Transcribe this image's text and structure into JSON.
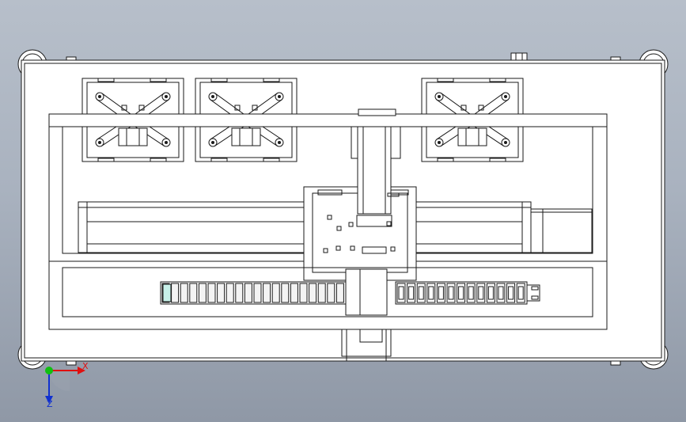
{
  "triad": {
    "x_label": "X",
    "z_label": "Z",
    "x_color": "#e01010",
    "z_color": "#1030d0",
    "origin_color": "#10c010"
  },
  "colors": {
    "background_top": "#b7bfca",
    "background_bottom": "#8f98a6",
    "part_fill": "#ffffff",
    "edge_line": "#1a1a1a",
    "highlight_link": "#c6f0e8"
  }
}
